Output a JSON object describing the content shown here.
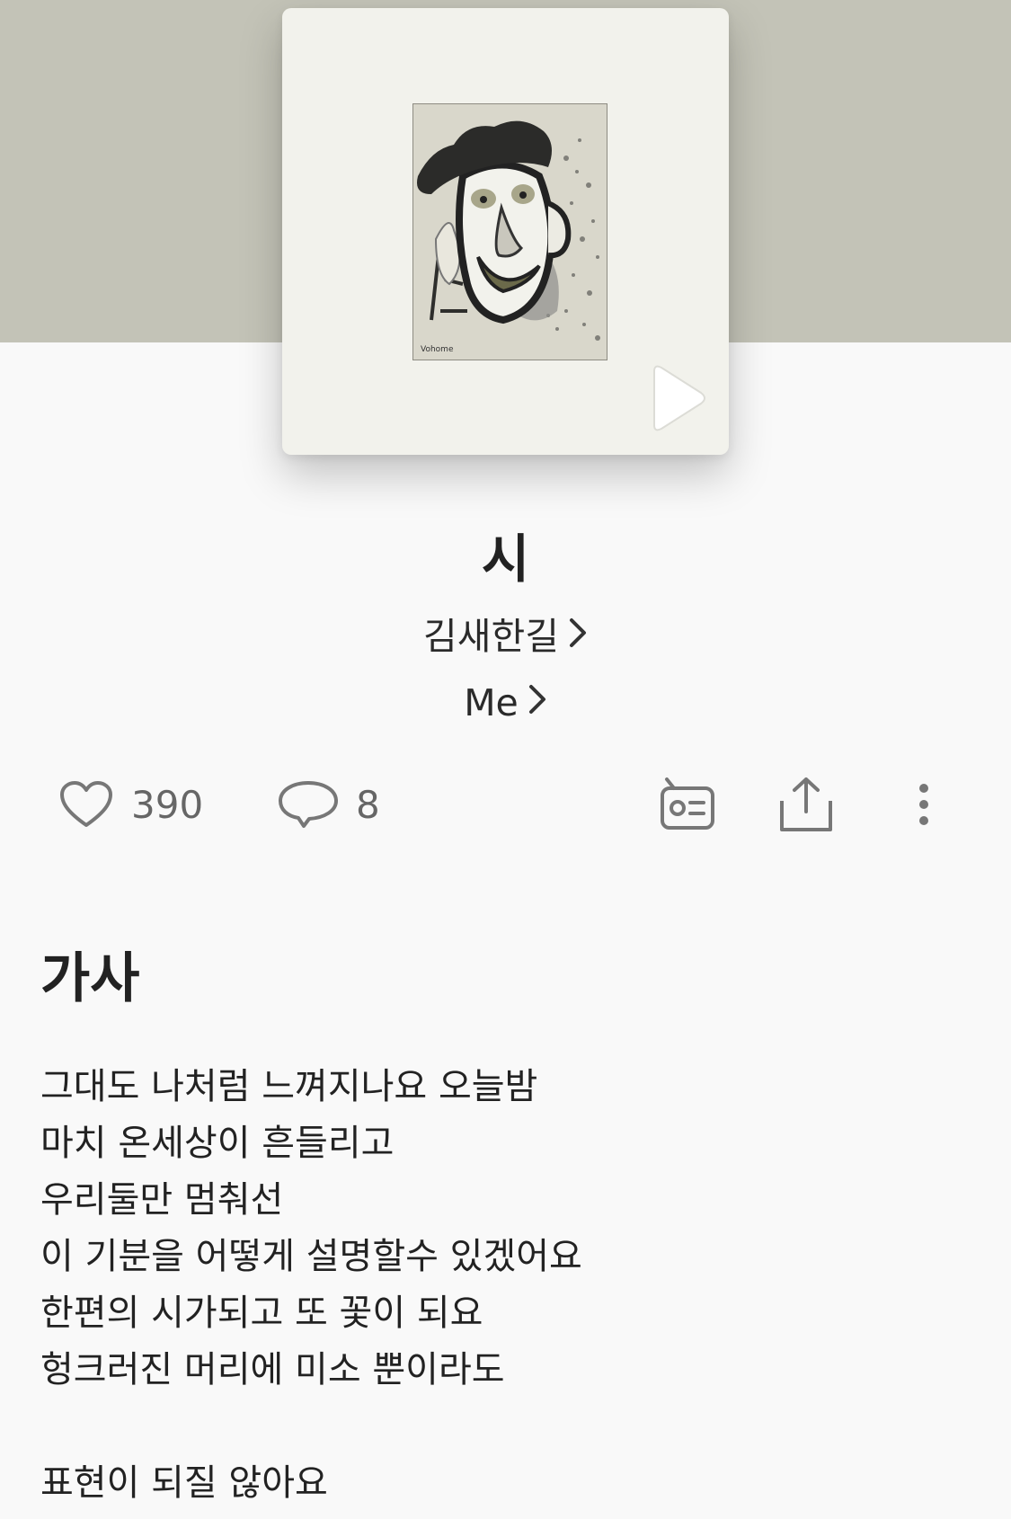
{
  "song": {
    "title": "시",
    "artist": "김새한길",
    "album": "Me"
  },
  "stats": {
    "likes": "390",
    "comments": "8"
  },
  "lyrics": {
    "heading": "가사",
    "lines": [
      "그대도 나처럼 느껴지나요 오늘밤",
      "마치 온세상이 흔들리고",
      "우리둘만 멈춰선",
      "이 기분을 어떻게 설명할수 있겠어요",
      "한편의 시가되고 또 꽃이 되요",
      "헝크러진 머리에 미소 뿐이라도",
      "",
      "표현이 되질 않아요"
    ]
  },
  "icons": {
    "play": "play-icon",
    "like": "heart-icon",
    "comment": "comment-icon",
    "radio": "radio-icon",
    "share": "share-icon",
    "more": "more-vertical-icon",
    "chevron": "chevron-right-icon"
  },
  "colors": {
    "header_background": "#c3c3b7",
    "page_background": "#f9f9f9",
    "cover_background": "#f2f2ec",
    "icon_gray": "#777777"
  }
}
